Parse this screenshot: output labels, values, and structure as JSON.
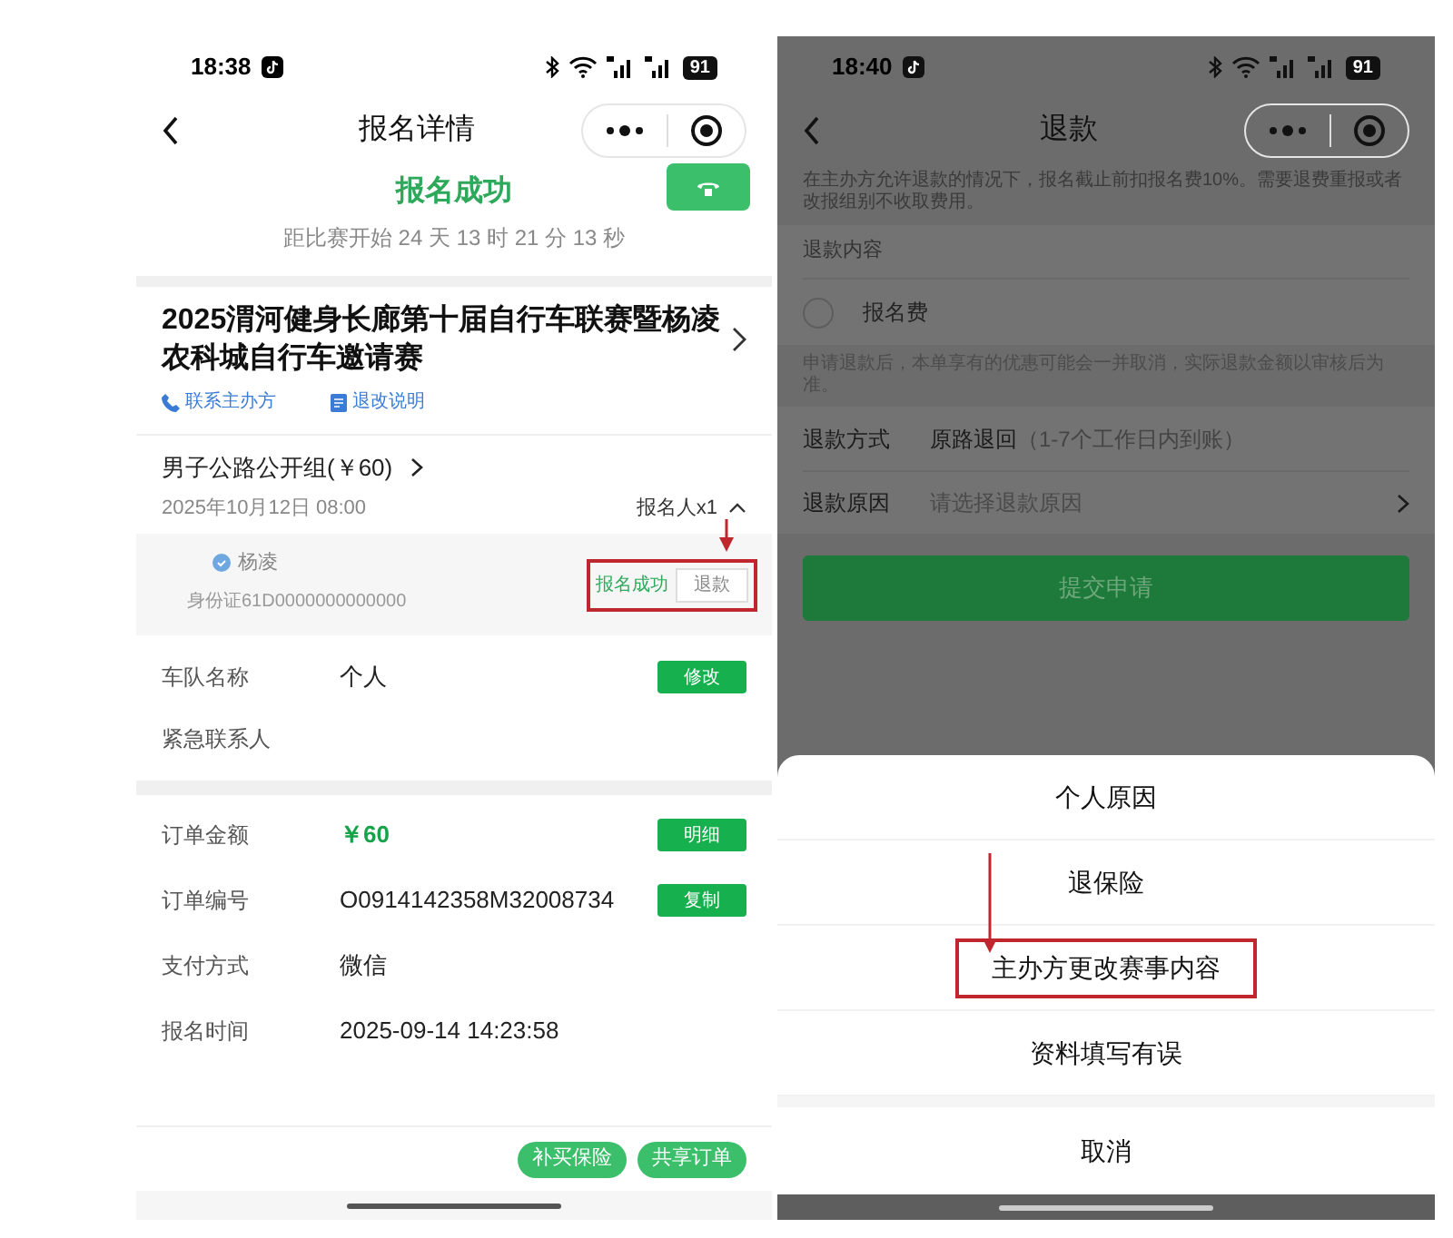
{
  "left": {
    "status_bar": {
      "time": "18:38",
      "battery": "91"
    },
    "nav": {
      "title": "报名详情"
    },
    "status_title": "报名成功",
    "countdown": "距比赛开始 24 天 13 时 21 分 13 秒",
    "event": {
      "title": "2025渭河健身长廊第十届自行车联赛暨杨凌农科城自行车邀请赛",
      "links": [
        {
          "kind": "phone",
          "label": "联系主办方"
        },
        {
          "kind": "doc",
          "label": "退改说明"
        }
      ]
    },
    "group": {
      "name": "男子公路公开组(￥60)",
      "date": "2025年10月12日 08:00",
      "count": "报名人x1",
      "expanded": true
    },
    "participant": {
      "name": "杨凌",
      "id": "身份证61D0000000000000",
      "status": "报名成功",
      "action": "退款",
      "highlighted": true
    },
    "team_rows": [
      {
        "label": "车队名称",
        "value": "个人",
        "button": "修改"
      },
      {
        "label": "紧急联系人"
      }
    ],
    "order_rows": [
      {
        "label": "订单金额",
        "value": "￥60",
        "kind": "amount",
        "button": "明细"
      },
      {
        "label": "订单编号",
        "value": "O0914142358M32008734",
        "kind": "text",
        "button": "复制"
      },
      {
        "label": "支付方式",
        "value": "微信",
        "kind": "text"
      },
      {
        "label": "报名时间",
        "value": "2025-09-14 14:23:58",
        "kind": "text"
      }
    ],
    "bottom_buttons": [
      "补买保险",
      "共享订单"
    ]
  },
  "right": {
    "status_bar": {
      "time": "18:40",
      "battery": "91"
    },
    "nav": {
      "title": "退款"
    },
    "notice": "在主办方允许退款的情况下，报名截止前扣报名费10%。需要退费重报或者改报组别不收取费用。",
    "content_label": "退款内容",
    "items": [
      {
        "label": "报名费",
        "checked": false
      }
    ],
    "note": "申请退款后，本单享有的优惠可能会一并取消，实际退款金额以审核后为准。",
    "method": {
      "label": "退款方式",
      "value": "原路退回",
      "hint": "（1-7个工作日内到账）"
    },
    "reason": {
      "label": "退款原因",
      "placeholder": "请选择退款原因"
    },
    "submit": "提交申请",
    "sheet": {
      "options": [
        {
          "label": "个人原因",
          "highlighted": false
        },
        {
          "label": "退保险",
          "highlighted": false
        },
        {
          "label": "主办方更改赛事内容",
          "highlighted": true
        },
        {
          "label": "资料填写有误",
          "highlighted": false
        }
      ],
      "cancel": "取消"
    }
  }
}
